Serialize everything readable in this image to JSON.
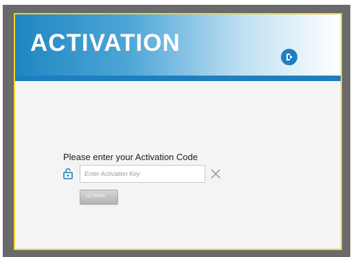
{
  "header": {
    "title": "ACTIVATION"
  },
  "form": {
    "prompt": "Please enter your Activation Code",
    "key_placeholder": "Enter Activation Key",
    "activate_label": "ACTIVATE"
  },
  "icons": {
    "exit": "exit-icon",
    "lock": "lock-icon",
    "clear": "clear-icon"
  },
  "colors": {
    "accent": "#1d7fc0",
    "frame": "#6a6a6a",
    "window_border": "#f2d52c",
    "button": "#c4c4c4"
  }
}
